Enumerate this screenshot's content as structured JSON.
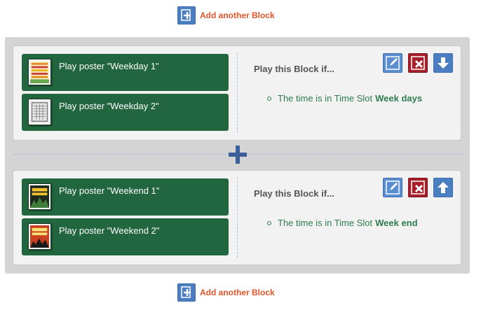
{
  "add_block_top": {
    "label": "Add another Block",
    "icon": "add-block-icon"
  },
  "add_block_bottom": {
    "label": "Add another Block",
    "icon": "add-block-icon"
  },
  "blocks": [
    {
      "posters": [
        {
          "label": "Play poster \"Weekday 1\"",
          "thumbnail_icon": "poster-thumbnail"
        },
        {
          "label": "Play poster \"Weekday 2\"",
          "thumbnail_icon": "poster-thumbnail"
        }
      ],
      "condition_title": "Play this Block if...",
      "condition": {
        "text": "The time is in Time Slot",
        "slot": "Week days"
      },
      "tools": {
        "edit_icon": "edit-icon",
        "delete_icon": "delete-icon",
        "move_icon": "arrow-down-icon"
      }
    },
    {
      "posters": [
        {
          "label": "Play poster \"Weekend 1\"",
          "thumbnail_icon": "poster-thumbnail"
        },
        {
          "label": "Play poster \"Weekend 2\"",
          "thumbnail_icon": "poster-thumbnail"
        }
      ],
      "condition_title": "Play this Block if...",
      "condition": {
        "text": "The time is in Time Slot",
        "slot": "Week end"
      },
      "tools": {
        "edit_icon": "edit-icon",
        "delete_icon": "delete-icon",
        "move_icon": "arrow-up-icon"
      }
    }
  ],
  "colors": {
    "poster_bg": "#22663f",
    "condition_text": "#2e7d4f",
    "add_label": "#e0552a",
    "edit_button": "#5b8ed0",
    "delete_button": "#a5202a",
    "separator_plus": "#3d5f99"
  }
}
